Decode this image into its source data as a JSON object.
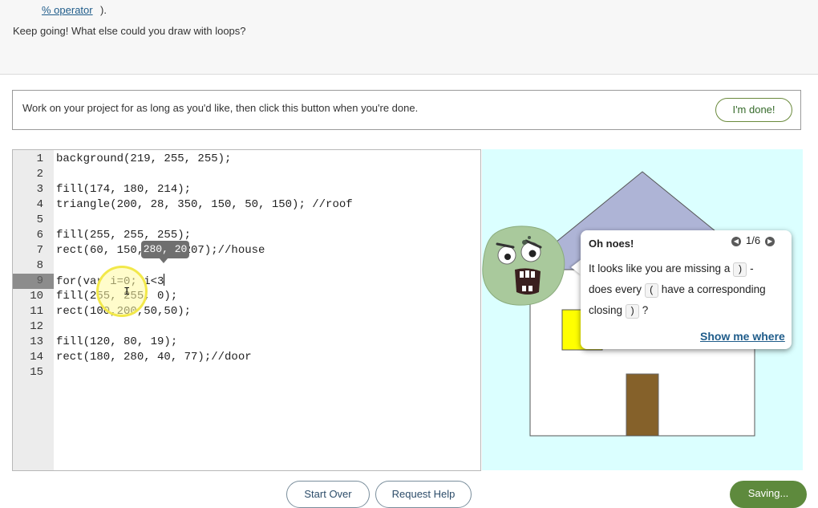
{
  "instructions": {
    "link_text": "% operator",
    "link_tail": ").",
    "keep_going": "Keep going! What else could you draw with loops?"
  },
  "project_bar": {
    "text": "Work on your project for as long as you'd like, then click this button when you're done.",
    "done_label": "I'm done!"
  },
  "editor": {
    "lines": [
      {
        "num": "1",
        "code": "background(219, 255, 255);"
      },
      {
        "num": "2",
        "code": ""
      },
      {
        "num": "3",
        "code": "fill(174, 180, 214);"
      },
      {
        "num": "4",
        "code": "triangle(200, 28, 350, 150, 50, 150); //roof"
      },
      {
        "num": "5",
        "code": ""
      },
      {
        "num": "6",
        "code": "fill(255, 255, 255);"
      },
      {
        "num": "7",
        "code": "rect(60, 150, 280, 207);//house"
      },
      {
        "num": "8",
        "code": ""
      },
      {
        "num": "9",
        "code": "for(var i=0; i<3"
      },
      {
        "num": "10",
        "code": "fill(255, 255, 0);"
      },
      {
        "num": "11",
        "code": "rect(100,200,50,50);"
      },
      {
        "num": "12",
        "code": ""
      },
      {
        "num": "13",
        "code": "fill(120, 80, 19);"
      },
      {
        "num": "14",
        "code": "rect(180, 280, 40, 77);//door"
      },
      {
        "num": "15",
        "code": ""
      }
    ],
    "active_line": "9",
    "tooltip": "280, 20"
  },
  "canvas": {
    "background": "#dbffff",
    "roof_color": "#aeb4d6",
    "house_color": "#ffffff",
    "window_color": "#ffff00",
    "door_color": "#785013"
  },
  "error_popup": {
    "title": "Oh noes!",
    "pager": "1/6",
    "line1_pre": "It looks like you are missing a",
    "line1_chip": ")",
    "line1_post": "-",
    "line2_pre": "does every",
    "line2_chip": "(",
    "line2_post": "have a corresponding",
    "line3_pre": "closing",
    "line3_chip": ")",
    "line3_post": "?",
    "show_me": "Show me where"
  },
  "buttons": {
    "start_over": "Start Over",
    "request_help": "Request Help",
    "saving": "Saving..."
  }
}
